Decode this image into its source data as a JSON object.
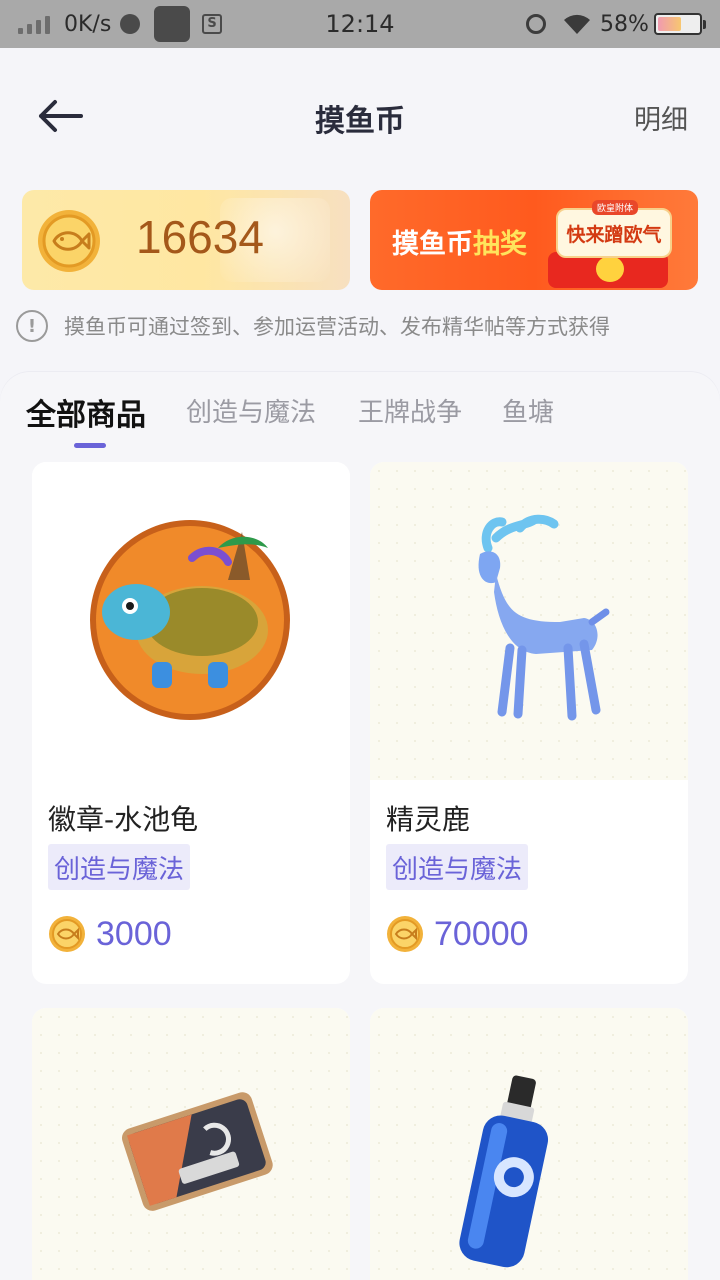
{
  "status_bar": {
    "net_speed": "0K/s",
    "time": "12:14",
    "battery": "58%"
  },
  "header": {
    "title": "摸鱼币",
    "detail_link": "明细"
  },
  "coin_card": {
    "balance": "16634"
  },
  "lottery_banner": {
    "title_prefix": "摸鱼币",
    "title_highlight": "抽奖",
    "badge": "快来蹭欧气",
    "small_badge": "欧皇附体"
  },
  "info": {
    "text": "摸鱼币可通过签到、参加运营活动、发布精华帖等方式获得"
  },
  "tabs": [
    {
      "label": "全部商品",
      "active": true
    },
    {
      "label": "创造与魔法",
      "active": false
    },
    {
      "label": "王牌战争",
      "active": false
    },
    {
      "label": "鱼塘",
      "active": false
    }
  ],
  "products": [
    {
      "name": "徽章-水池龟",
      "tag": "创造与魔法",
      "price": "3000",
      "image_icon": "turtle-badge-image"
    },
    {
      "name": "精灵鹿",
      "tag": "创造与魔法",
      "price": "70000",
      "image_icon": "spirit-deer-image"
    },
    {
      "name": "",
      "tag": "",
      "price": "",
      "image_icon": "rename-card-image"
    },
    {
      "name": "",
      "tag": "",
      "price": "",
      "image_icon": "water-bottle-image"
    }
  ],
  "colors": {
    "accent": "#6a63d8",
    "balance": "#a4581a",
    "lottery": "#ff5a1e"
  }
}
